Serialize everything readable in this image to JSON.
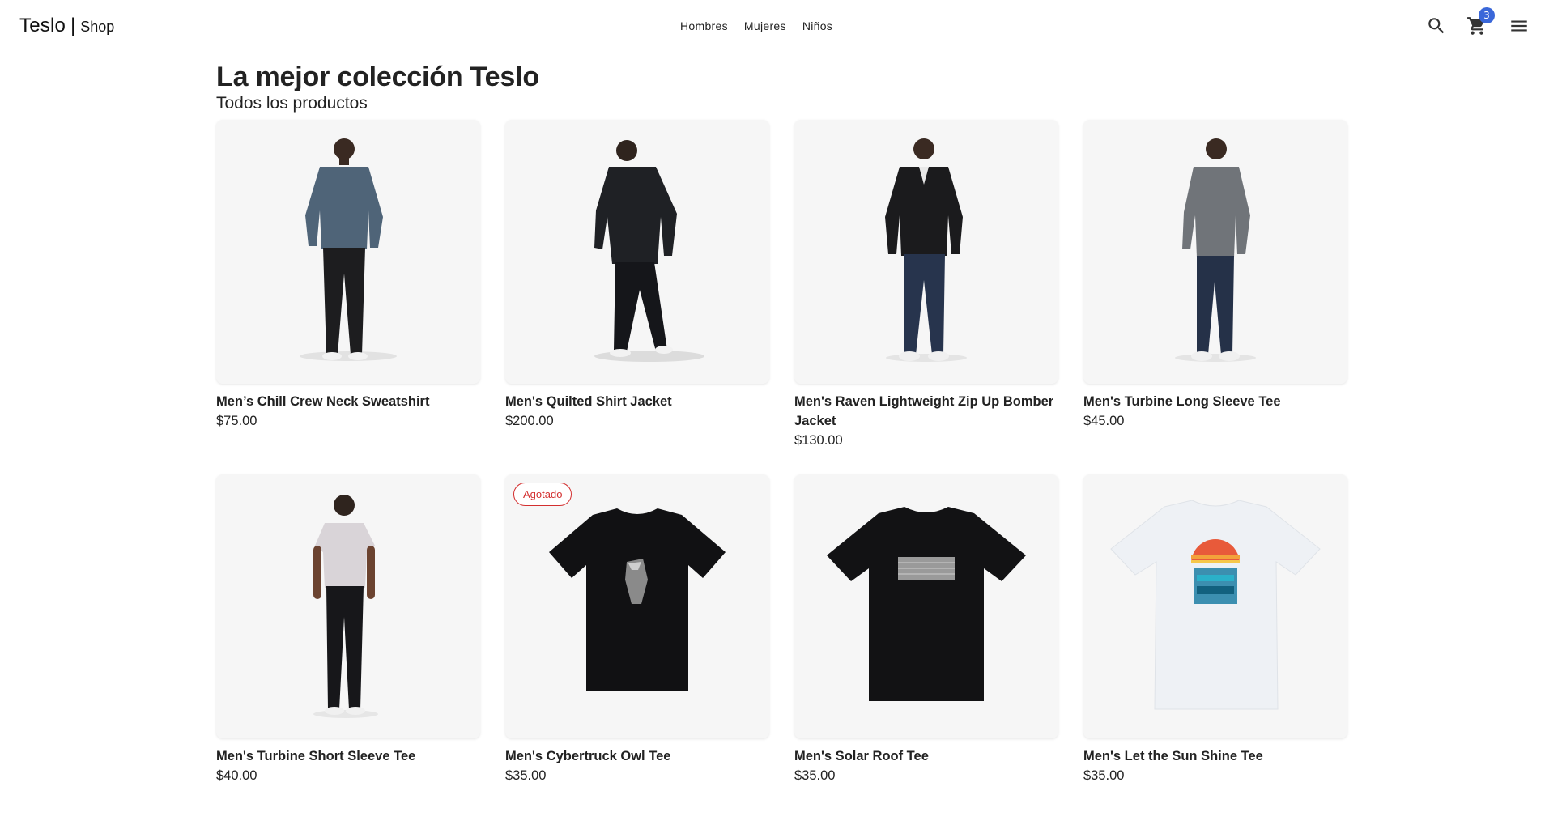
{
  "brand": {
    "name": "Teslo",
    "separator": "|",
    "suffix": "Shop"
  },
  "nav": {
    "links": [
      "Hombres",
      "Mujeres",
      "Niños"
    ]
  },
  "actions": {
    "search_icon": "search-icon",
    "cart_icon": "shopping-cart-icon",
    "cart_count": "3",
    "menu_icon": "menu-icon"
  },
  "colors": {
    "badge": "#3a67d9",
    "sold_out": "#d32f2f",
    "card_bg": "#f6f6f6"
  },
  "page": {
    "title": "La mejor colección Teslo",
    "subtitle": "Todos los productos"
  },
  "products": [
    {
      "title": "Men’s Chill Crew Neck Sweatshirt",
      "price": "$75.00",
      "badge": "",
      "image": "model-blue-sweatshirt"
    },
    {
      "title": "Men's Quilted Shirt Jacket",
      "price": "$200.00",
      "badge": "",
      "image": "model-black-quilted-jacket"
    },
    {
      "title": "Men's Raven Lightweight Zip Up Bomber Jacket",
      "price": "$130.00",
      "badge": "",
      "image": "model-black-bomber-jacket"
    },
    {
      "title": "Men's Turbine Long Sleeve Tee",
      "price": "$45.00",
      "badge": "",
      "image": "model-grey-long-sleeve-tee"
    },
    {
      "title": "Men's Turbine Short Sleeve Tee",
      "price": "$40.00",
      "badge": "",
      "image": "model-white-short-sleeve-tee"
    },
    {
      "title": "Men's Cybertruck Owl Tee",
      "price": "$35.00",
      "badge": "Agotado",
      "image": "black-tee-owl-print"
    },
    {
      "title": "Men's Solar Roof Tee",
      "price": "$35.00",
      "badge": "",
      "image": "black-tee-solar-roof-print"
    },
    {
      "title": "Men's Let the Sun Shine Tee",
      "price": "$35.00",
      "badge": "",
      "image": "white-tee-sunshine-print"
    }
  ]
}
